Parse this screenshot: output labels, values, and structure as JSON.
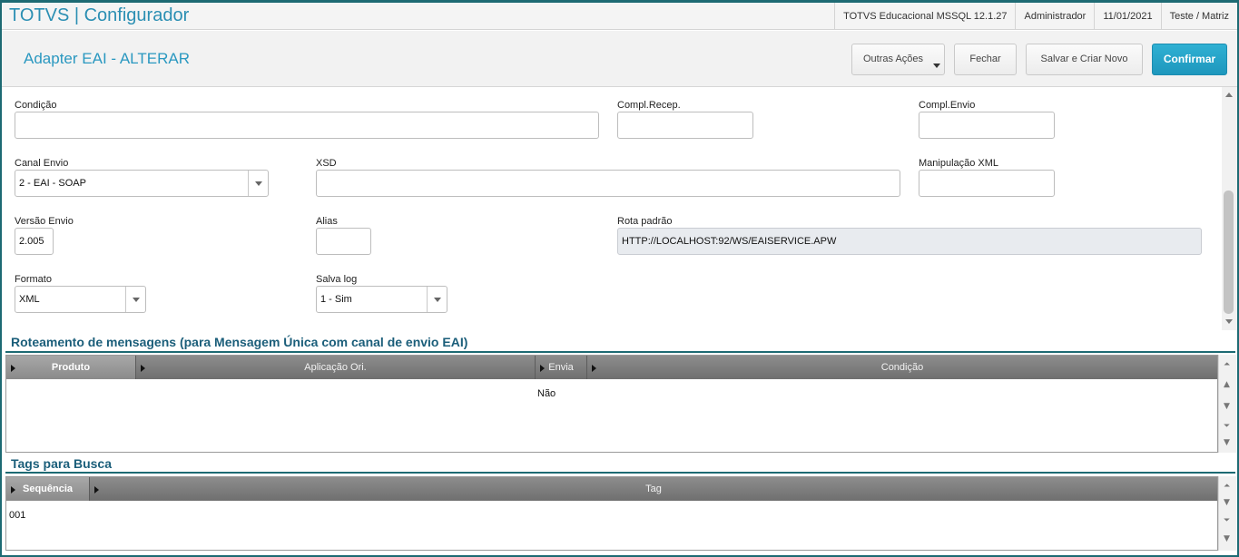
{
  "app": {
    "title": "TOTVS | Configurador",
    "environment": "TOTVS Educacional MSSQL 12.1.27",
    "user": "Administrador",
    "date": "11/01/2021",
    "branch": "Teste / Matriz"
  },
  "header": {
    "title": "Adapter EAI - ALTERAR",
    "buttons": {
      "outras_acoes": "Outras Ações",
      "fechar": "Fechar",
      "salvar_novo": "Salvar e Criar Novo",
      "confirmar": "Confirmar"
    }
  },
  "form": {
    "condicao": {
      "label": "Condição",
      "value": ""
    },
    "compl_recep": {
      "label": "Compl.Recep.",
      "value": ""
    },
    "compl_envio": {
      "label": "Compl.Envio",
      "value": ""
    },
    "canal_envio": {
      "label": "Canal Envio",
      "value": "2 - EAI - SOAP"
    },
    "xsd": {
      "label": "XSD",
      "value": ""
    },
    "manipulacao_xml": {
      "label": "Manipulação XML",
      "value": ""
    },
    "versao_envio": {
      "label": "Versão Envio",
      "value": "2.005"
    },
    "alias": {
      "label": "Alias",
      "value": ""
    },
    "rota_padrao": {
      "label": "Rota padrão",
      "value": "HTTP://LOCALHOST:92/WS/EAISERVICE.APW"
    },
    "formato": {
      "label": "Formato",
      "value": "XML"
    },
    "salva_log": {
      "label": "Salva log",
      "value": "1 - Sim"
    }
  },
  "roteamento": {
    "title": "Roteamento de mensagens (para Mensagem Única com canal de envio EAI)",
    "columns": [
      "Produto",
      "Aplicação Ori.",
      "Envia",
      "Condição"
    ],
    "rows": [
      {
        "produto": "",
        "aplicacao": "",
        "envia": "Não",
        "condicao": ""
      }
    ]
  },
  "tags": {
    "title": "Tags para Busca",
    "columns": [
      "Sequência",
      "Tag"
    ],
    "rows": [
      {
        "sequencia": "001",
        "tag": ""
      }
    ]
  }
}
